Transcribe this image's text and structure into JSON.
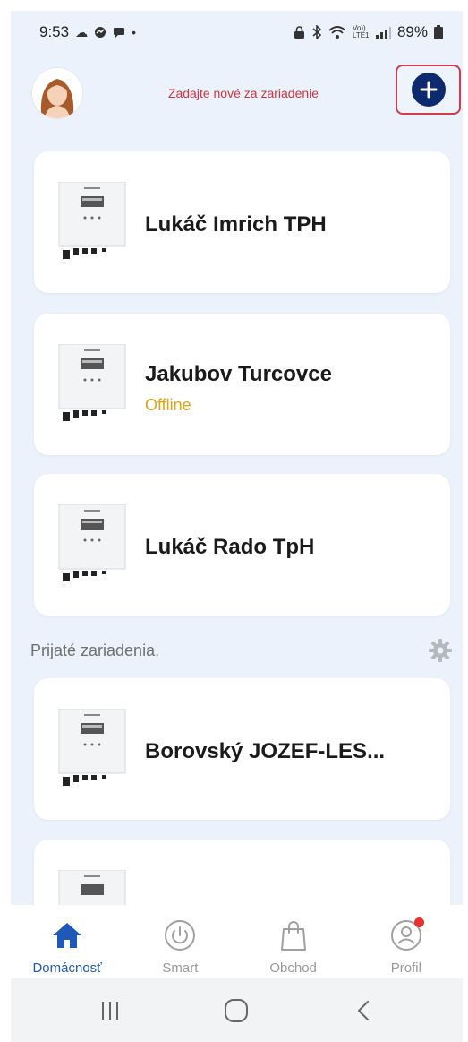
{
  "status_bar": {
    "time": "9:53",
    "network": "Vo)) LTE1",
    "battery": "89%"
  },
  "header": {
    "title": "Zadajte nové za zariadenie",
    "add_button_icon": "plus-icon",
    "accent": "#0e2a6e",
    "highlight": "#d23c48"
  },
  "devices": [
    {
      "name": "Lukáč Imrich TPH",
      "status": ""
    },
    {
      "name": "Jakubov Turcovce",
      "status": "Offline"
    },
    {
      "name": "Lukáč Rado TpH",
      "status": ""
    }
  ],
  "received_section": {
    "label": "Prijaté zariadenia.",
    "settings_icon": "gear-icon",
    "devices": [
      {
        "name": "Borovský JOZEF-LES...",
        "status": ""
      },
      {
        "name": "",
        "status": ""
      }
    ]
  },
  "bottom_nav": {
    "items": [
      {
        "label": "Domácnosť",
        "icon": "home-icon",
        "active": true
      },
      {
        "label": "Smart",
        "icon": "power-icon",
        "active": false
      },
      {
        "label": "Obchod",
        "icon": "shopping-bag-icon",
        "active": false
      },
      {
        "label": "Profil",
        "icon": "profile-icon",
        "active": false,
        "badge": true
      }
    ],
    "active_color": "#1e58b8"
  },
  "system_nav": {
    "recents_icon": "recents-icon",
    "home_icon": "home-circle-icon",
    "back_icon": "back-icon"
  }
}
